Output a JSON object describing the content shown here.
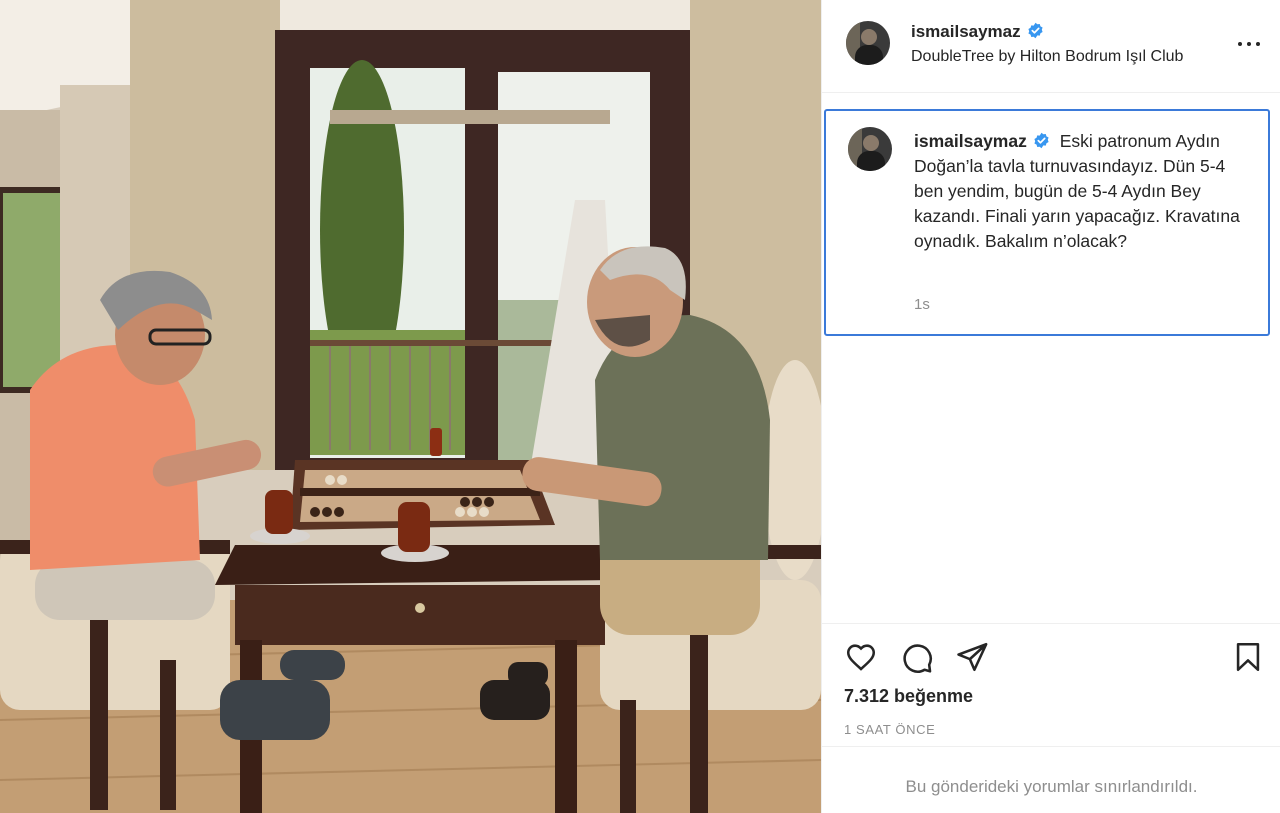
{
  "post": {
    "username": "ismailsaymaz",
    "location": "DoubleTree by Hilton Bodrum Işıl Club",
    "caption": "Eski patronum Aydın Doğan’la tavla turnuvasındayız. Dün 5-4 ben yendim, bugün de 5-4 Aydın Bey kazandı. Finali yarın yapacağız. Kravatına oynadık. Bakalım n’olacak?",
    "caption_time": "1s",
    "likes": "7.312 beğenme",
    "time_ago": "1 SAAT ÖNCE",
    "comments_notice": "Bu gönderideki yorumlar sınırlandırıldı."
  },
  "icons": {
    "verified": "verified-badge-icon",
    "more": "more-options-icon",
    "like": "heart-icon",
    "comment": "comment-icon",
    "share": "send-icon",
    "save": "bookmark-icon"
  },
  "colors": {
    "verified_blue": "#3897f0",
    "focus_border": "#3b7ad9",
    "text": "#262626",
    "secondary_text": "#8e8e8e"
  }
}
